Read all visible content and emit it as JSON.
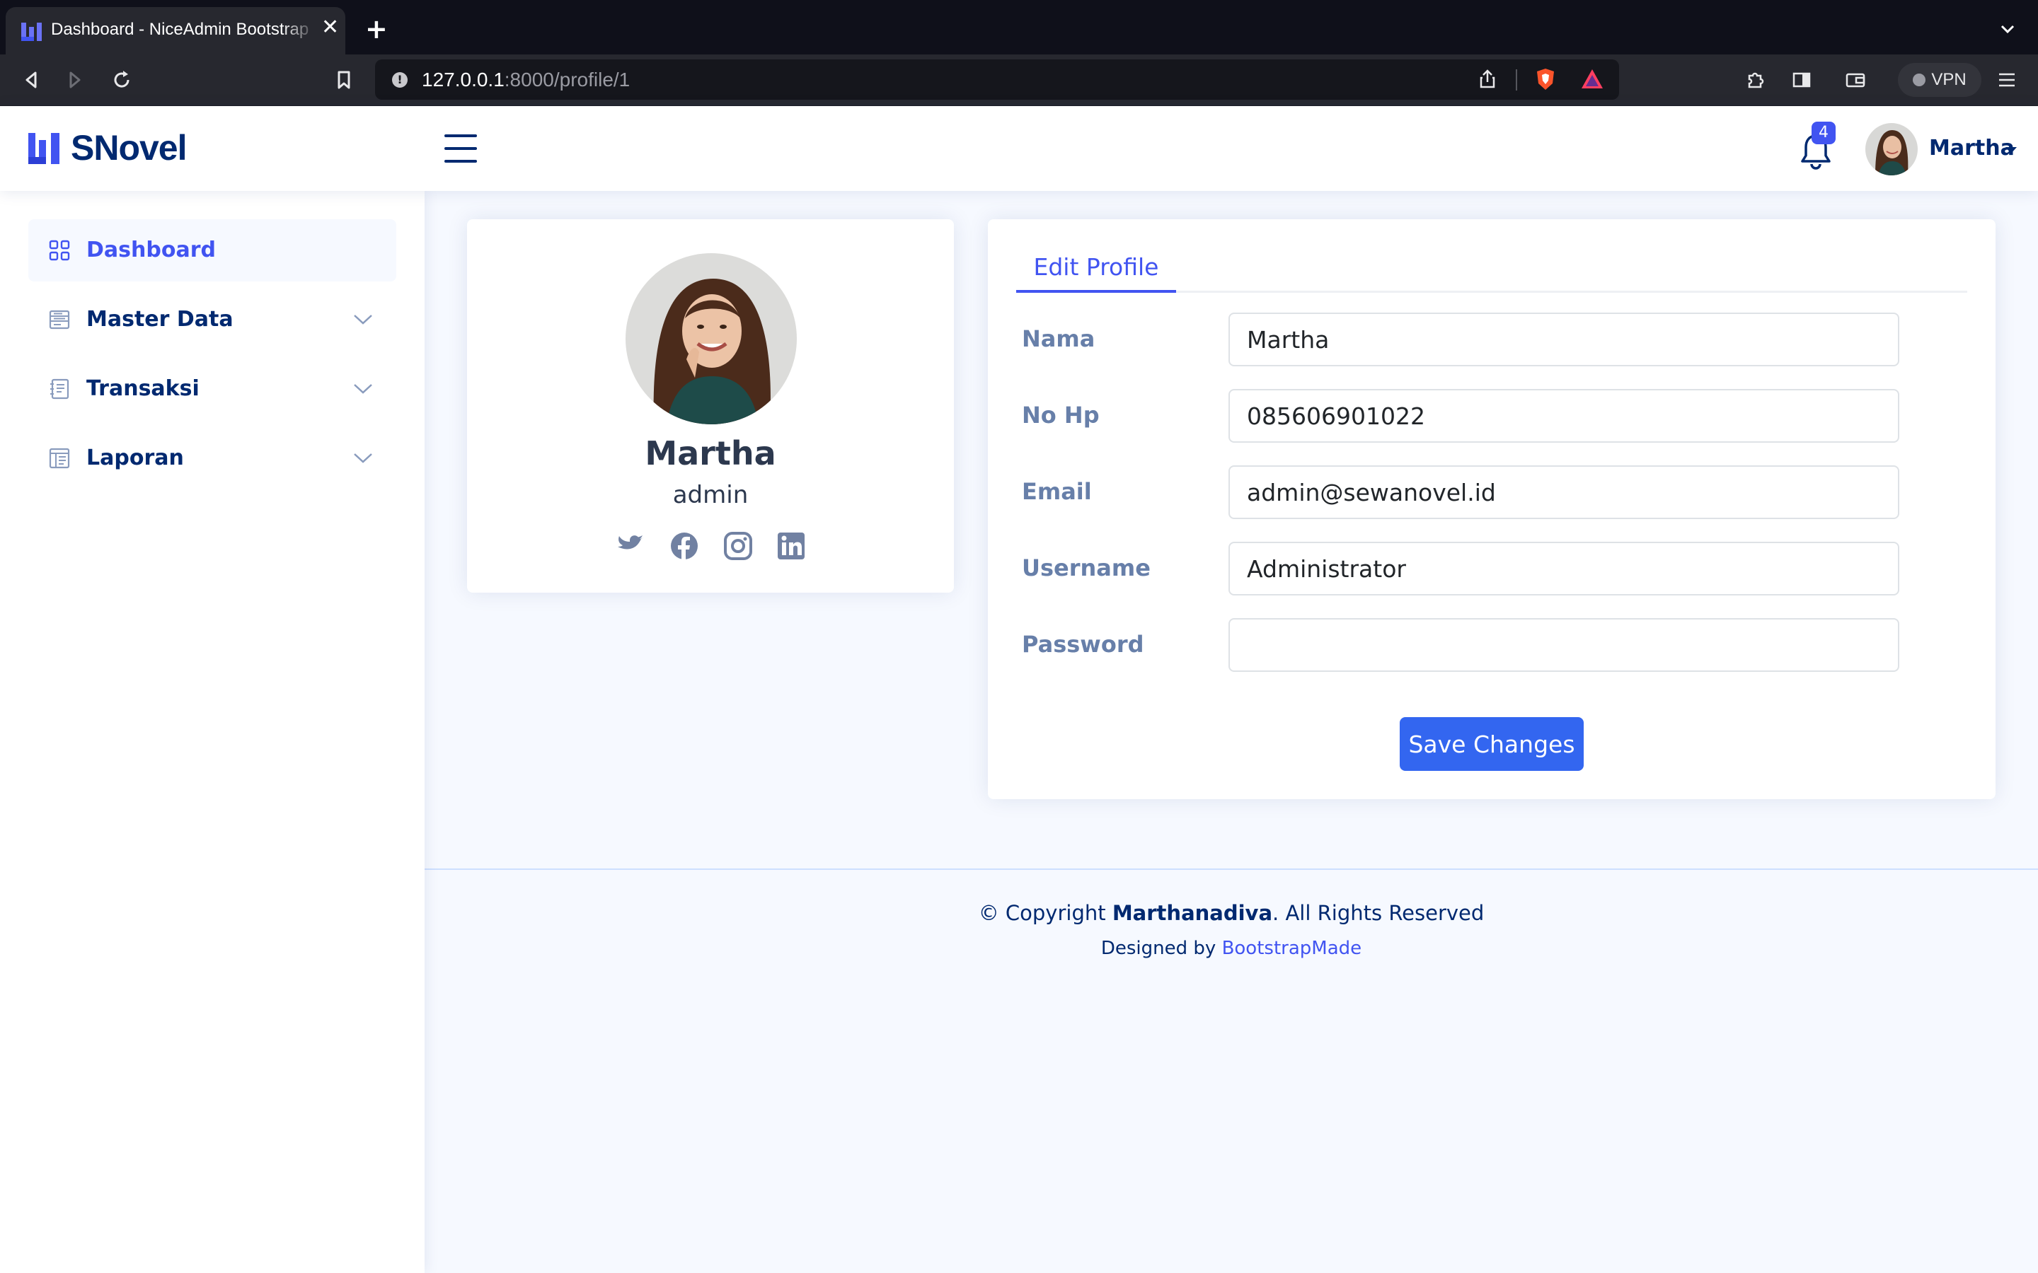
{
  "browser": {
    "tab_title": "Dashboard - NiceAdmin Bootstrap Template",
    "close_glyph": "✕",
    "new_tab_glyph": "+",
    "url_host": "127.0.0.1",
    "url_path": ":8000/profile/1",
    "vpn_label": "VPN",
    "icons": [
      "back-icon",
      "forward-icon",
      "reload-icon",
      "bookmark-icon",
      "info-icon",
      "share-icon",
      "brave-shield-icon",
      "brave-rewards-icon",
      "extensions-icon",
      "sidebar-icon",
      "wallet-icon",
      "menu-icon"
    ]
  },
  "header": {
    "logo_text": "SNovel",
    "notification_count": "4",
    "user_name": "Martha"
  },
  "sidebar": {
    "items": [
      {
        "label": "Dashboard",
        "icon": "grid-icon",
        "active": true
      },
      {
        "label": "Master Data",
        "icon": "layout-text-icon",
        "expandable": true
      },
      {
        "label": "Transaksi",
        "icon": "journal-text-icon",
        "expandable": true
      },
      {
        "label": "Laporan",
        "icon": "layout-text-window-icon",
        "expandable": true
      }
    ]
  },
  "profile": {
    "name": "Martha",
    "role": "admin",
    "socials": [
      "twitter-icon",
      "facebook-icon",
      "instagram-icon",
      "linkedin-icon"
    ]
  },
  "edit_profile": {
    "tab_label": "Edit Profile",
    "fields": [
      {
        "label": "Nama",
        "value": "Martha"
      },
      {
        "label": "No Hp",
        "value": "085606901022"
      },
      {
        "label": "Email",
        "value": "admin@sewanovel.id"
      },
      {
        "label": "Username",
        "value": "Administrator"
      },
      {
        "label": "Password",
        "value": ""
      }
    ],
    "save_label": "Save Changes"
  },
  "footer": {
    "copyright_prefix": "© Copyright ",
    "copyright_owner": "Marthanadiva",
    "copyright_suffix": ". All Rights Reserved",
    "designed_by": "Designed by ",
    "designer_link": "BootstrapMade"
  },
  "colors": {
    "brand": "#012970",
    "accent": "#4154f1",
    "button": "#3366f0",
    "background": "#f6f9ff"
  }
}
